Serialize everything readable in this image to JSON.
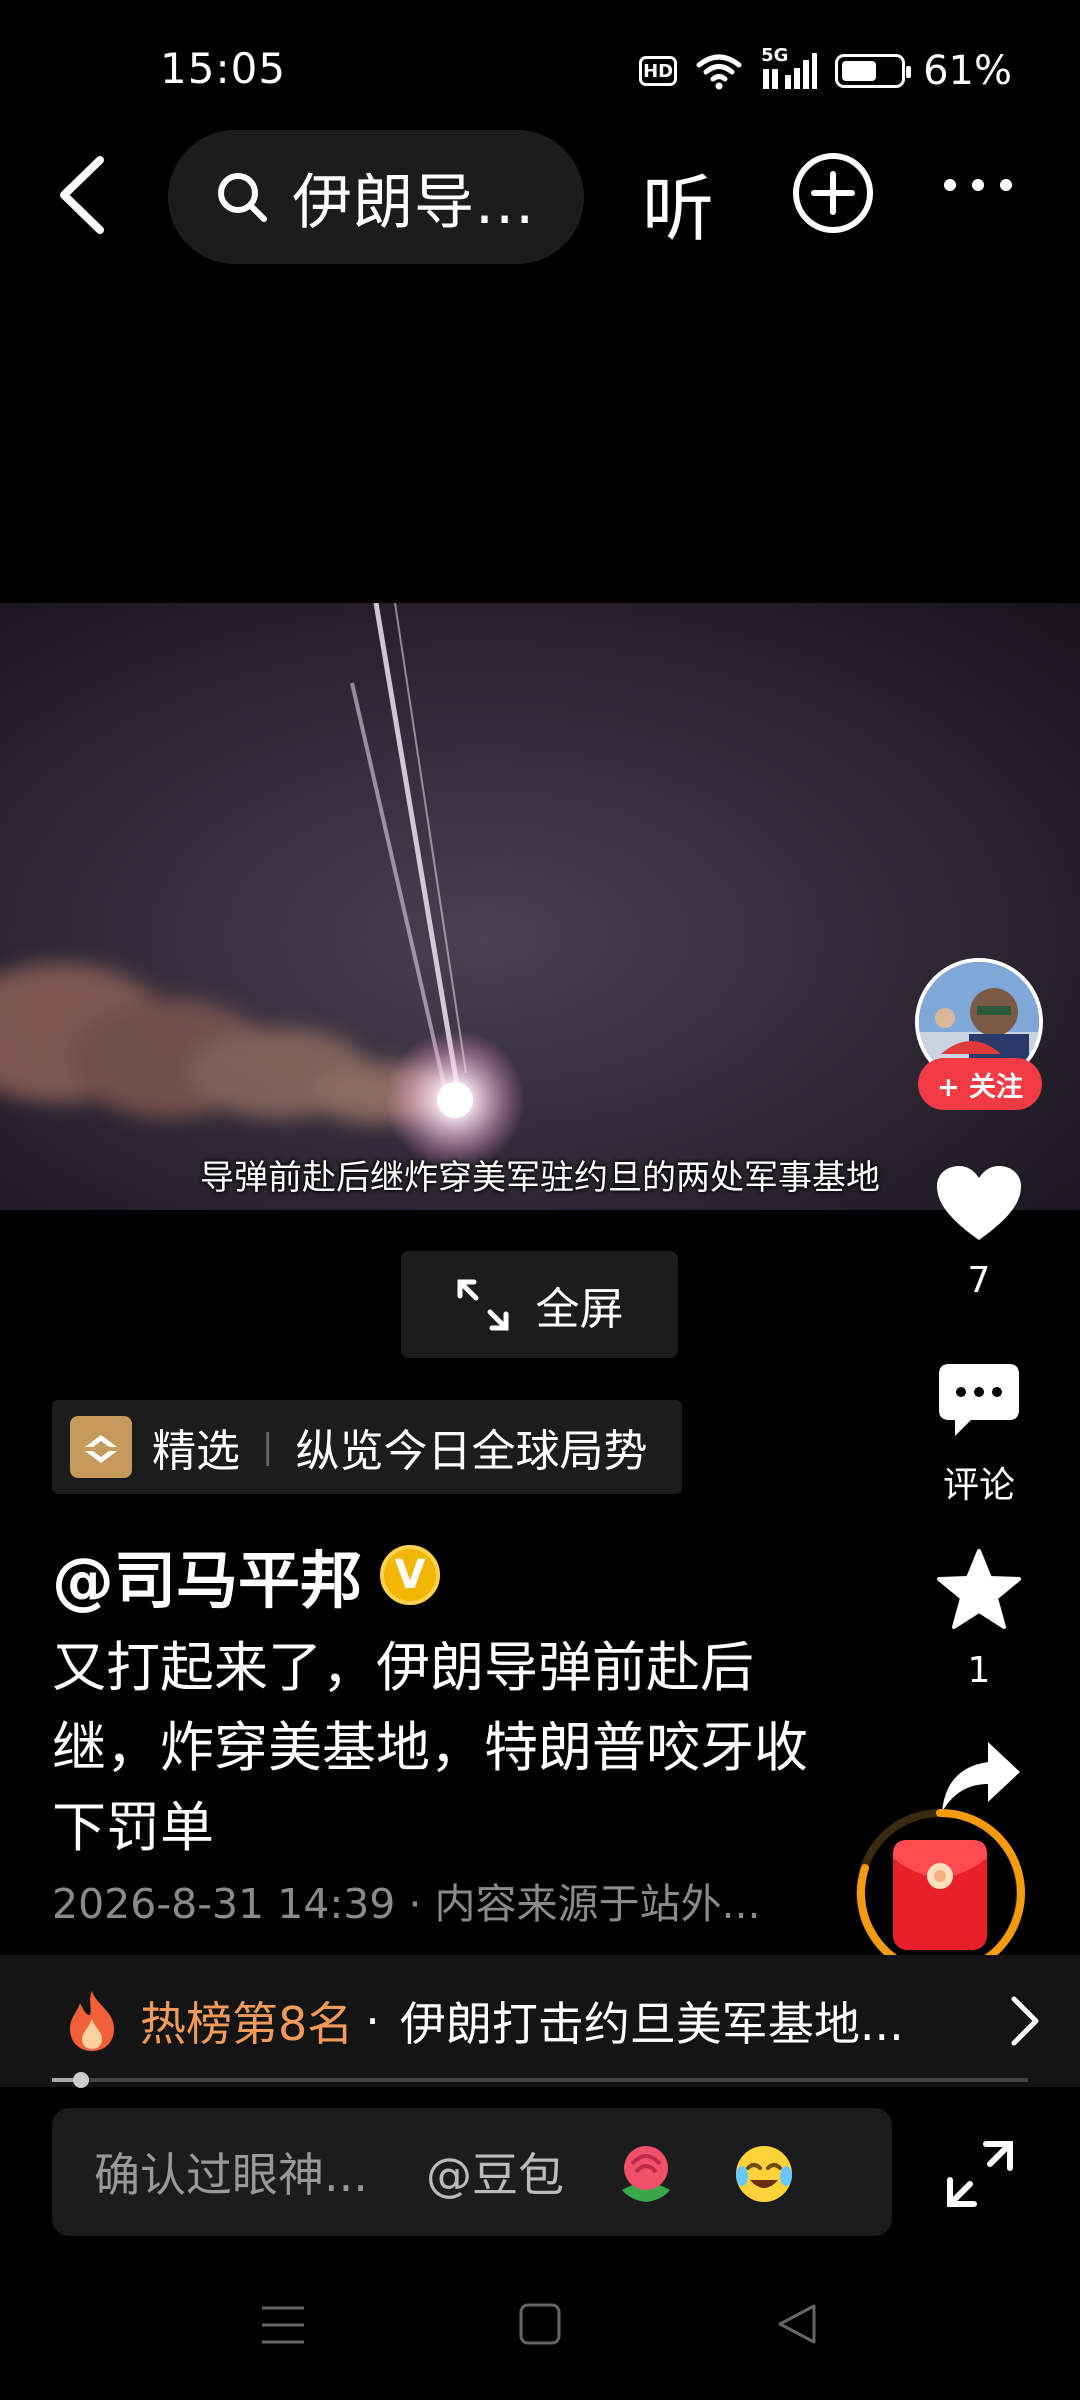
{
  "status_bar": {
    "time": "15:05",
    "hd": "HD",
    "network": "5G",
    "battery": "61%",
    "battery_level": 0.61
  },
  "top_nav": {
    "search_query": "伊朗导...",
    "listen_label": "听"
  },
  "video": {
    "subtitle": "导弹前赴后继炸穿美军驻约旦的两处军事基地",
    "fullscreen_label": "全屏"
  },
  "rail": {
    "follow_label": "+ 关注",
    "like_count": "7",
    "comment_label": "评论",
    "favorite_count": "1"
  },
  "post": {
    "channel_tag": "精选",
    "channel_name": "纵览今日全球局势",
    "author": "@司马平邦",
    "verified_mark": "V",
    "text": "又打起来了，伊朗导弹前赴后继，炸穿美基地，特朗普咬牙收下罚单",
    "meta": "2026-8-31 14:39 · 内容来源于站外..."
  },
  "hot": {
    "rank": "热榜第8名",
    "separator": "·",
    "title": "伊朗打击约旦美军基地..."
  },
  "playback": {
    "progress": 0.03
  },
  "comment_bar": {
    "placeholder": "确认过眼神...",
    "mention": "@豆包"
  },
  "colors": {
    "follow_red": "#f23a45",
    "hot_orange": "#f29a5a",
    "verified_gold": "#f2b705",
    "red_packet_ring": "#f59b0f"
  },
  "icons": [
    "back-icon",
    "search-icon",
    "add-circle-icon",
    "more-icon",
    "fullscreen-icon",
    "heart-icon",
    "comment-icon",
    "star-icon",
    "share-icon",
    "fire-icon",
    "chevron-right-icon",
    "rose-emoji-icon",
    "laugh-cry-emoji-icon",
    "expand-icon",
    "menu-nav-icon",
    "home-nav-icon",
    "back-nav-icon",
    "red-packet-icon"
  ]
}
